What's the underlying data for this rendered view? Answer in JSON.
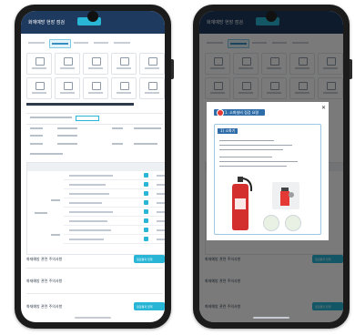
{
  "app": {
    "title": "화재예방 현장 점검",
    "badge": "",
    "cta_label": "점검결과 입력"
  },
  "tabs": [
    {
      "label": "",
      "active": false
    },
    {
      "label": "",
      "active": true
    },
    {
      "label": "",
      "active": false
    },
    {
      "label": "",
      "active": false
    },
    {
      "label": "",
      "active": false
    }
  ],
  "sections": {
    "section1": "화재예방 관련 주의사항",
    "section2": "화재예방 관련 주의사항",
    "section3": "화재예방 관련 주의사항"
  },
  "modal": {
    "header": "1. 소화설비 점검 요령",
    "subtitle": "1) 소화기",
    "close": "✕"
  },
  "colors": {
    "accent": "#29b6d6",
    "topbar": "#1f3a5f",
    "modal_header": "#2f6da8"
  }
}
